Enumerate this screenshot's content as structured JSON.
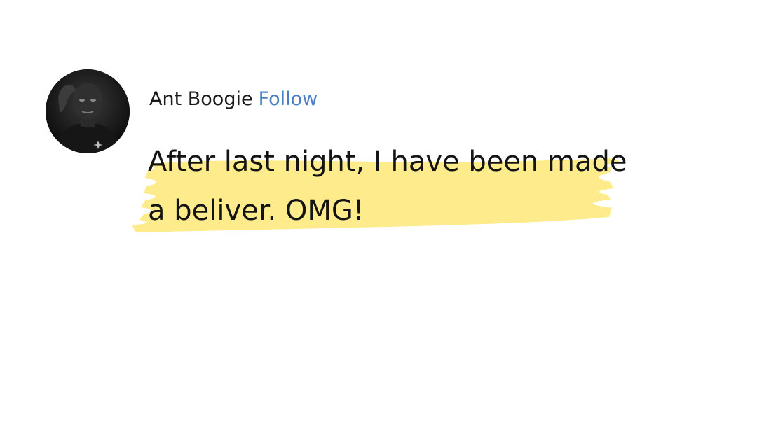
{
  "post": {
    "author_name": "Ant Boogie",
    "follow_label": "Follow",
    "text": "After last night, I have been made a beliver. OMG!",
    "highlight_color": "#fdeb8c",
    "follow_color": "#4a7fc8",
    "avatar_icon": "user-photo-avatar"
  }
}
